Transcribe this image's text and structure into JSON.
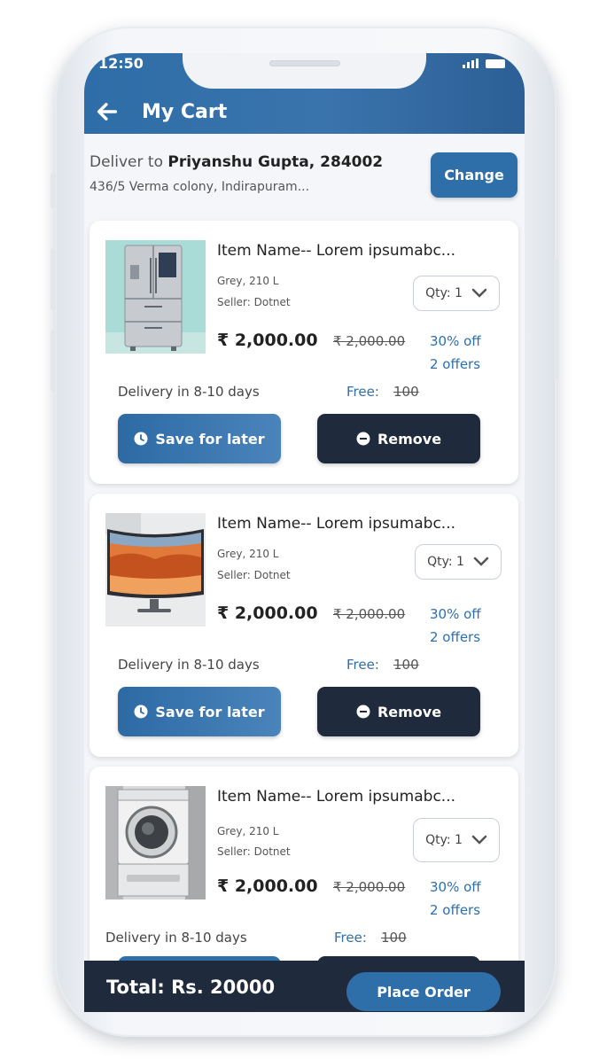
{
  "status_bar": {
    "time": "12:50"
  },
  "app_bar": {
    "title": "My Cart"
  },
  "address": {
    "deliver_prefix": "Deliver to ",
    "name_pin": "Priyanshu Gupta, 284002",
    "line": "436/5 Verma colony, Indirapuram...",
    "change_label": "Change"
  },
  "items": [
    {
      "name": "Item Name-- Lorem ipsumabc...",
      "variant": "Grey, 210 L",
      "seller": "Seller: Dotnet",
      "qty": "Qty: 1",
      "price": "₹ 2,000.00",
      "mrp": "₹ 2,000.00",
      "discount": "30% off",
      "offers": "2 offers",
      "delivery": "Delivery in 8-10 days",
      "delivery_fee_label": "Free:",
      "delivery_fee_old": "100",
      "image": "refrigerator"
    },
    {
      "name": "Item Name-- Lorem ipsumabc...",
      "variant": "Grey, 210 L",
      "seller": "Seller: Dotnet",
      "qty": "Qty: 1",
      "price": "₹ 2,000.00",
      "mrp": "₹ 2,000.00",
      "discount": "30% off",
      "offers": "2 offers",
      "delivery": "Delivery in 8-10 days",
      "delivery_fee_label": "Free:",
      "delivery_fee_old": "100",
      "image": "curved-monitor"
    },
    {
      "name": "Item Name-- Lorem ipsumabc...",
      "variant": "Grey, 210 L",
      "seller": "Seller: Dotnet",
      "qty": "Qty: 1",
      "price": "₹ 2,000.00",
      "mrp": "₹ 2,000.00",
      "discount": "30% off",
      "offers": "2 offers",
      "delivery": "Delivery in 8-10 days",
      "delivery_fee_label": "Free:",
      "delivery_fee_old": "100",
      "image": "washing-machine"
    }
  ],
  "actions": {
    "save_label": "Save for later",
    "remove_label": "Remove"
  },
  "footer": {
    "total": "Total: Rs. 20000",
    "place_order_label": "Place Order"
  },
  "colors": {
    "primary": "#2f6fa9",
    "dark": "#1f2a3c",
    "background": "#f4f6f9"
  }
}
